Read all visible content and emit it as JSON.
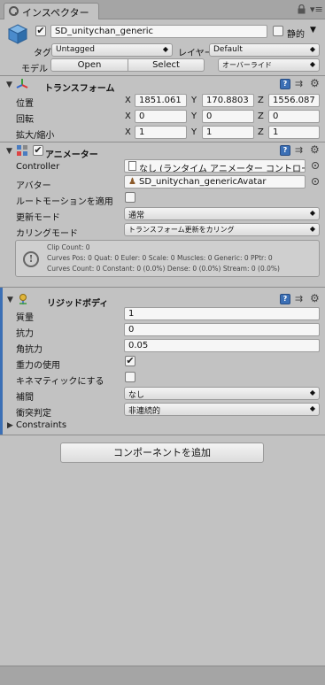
{
  "tab": {
    "title": "インスペクター"
  },
  "header": {
    "object_name": "SD_unitychan_generic",
    "static_label": "静的",
    "tag_label": "タグ",
    "tag_value": "Untagged",
    "layer_label": "レイヤー",
    "layer_value": "Default",
    "model_label": "モデル",
    "open_label": "Open",
    "select_label": "Select",
    "overrides_label": "オーバーライド"
  },
  "transform": {
    "title": "トランスフォーム",
    "position_label": "位置",
    "rotation_label": "回転",
    "scale_label": "拡大/縮小",
    "axes": [
      "X",
      "Y",
      "Z"
    ],
    "position": [
      "1851.061",
      "170.8803",
      "1556.087"
    ],
    "rotation": [
      "0",
      "0",
      "0"
    ],
    "scale": [
      "1",
      "1",
      "1"
    ]
  },
  "animator": {
    "title": "アニメーター",
    "controller_label": "Controller",
    "controller_value": "なし (ランタイム アニメーター コントローラー)",
    "avatar_label": "アバター",
    "avatar_value": "SD_unitychan_genericAvatar",
    "root_motion_label": "ルートモーションを適用",
    "update_mode_label": "更新モード",
    "update_mode_value": "通常",
    "culling_mode_label": "カリングモード",
    "culling_mode_value": "トランスフォーム更新をカリング",
    "info_line1": "Clip Count: 0",
    "info_line2": "Curves Pos: 0 Quat: 0 Euler: 0 Scale: 0 Muscles: 0 Generic: 0 PPtr: 0",
    "info_line3": "Curves Count: 0 Constant: 0 (0.0%) Dense: 0 (0.0%) Stream: 0 (0.0%)"
  },
  "rigidbody": {
    "title": "リジッドボディ",
    "mass_label": "質量",
    "mass_value": "1",
    "drag_label": "抗力",
    "drag_value": "0",
    "angular_drag_label": "角抗力",
    "angular_drag_value": "0.05",
    "use_gravity_label": "重力の使用",
    "is_kinematic_label": "キネマティックにする",
    "interpolate_label": "補間",
    "interpolate_value": "なし",
    "collision_label": "衝突判定",
    "collision_value": "非連続的",
    "constraints_label": "Constraints"
  },
  "add_component_label": "コンポーネントを追加",
  "colors": {
    "accent": "#3b6fb5",
    "panel": "#c2c2c2",
    "field": "#f6f6f6"
  }
}
